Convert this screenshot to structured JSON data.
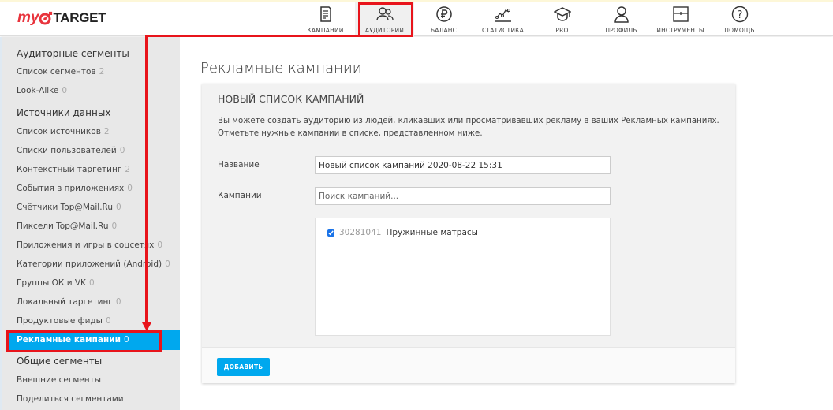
{
  "logo": {
    "my": "my",
    "target": "TARGET"
  },
  "nav": [
    {
      "label": "КАМПАНИИ",
      "icon": "document-icon"
    },
    {
      "label": "АУДИТОРИИ",
      "icon": "users-icon"
    },
    {
      "label": "БАЛАНС",
      "icon": "ruble-icon"
    },
    {
      "label": "СТАТИСТИКА",
      "icon": "chart-line-icon"
    },
    {
      "label": "PRO",
      "icon": "graduation-cap-icon"
    },
    {
      "label": "ПРОФИЛЬ",
      "icon": "user-icon"
    },
    {
      "label": "ИНСТРУМЕНТЫ",
      "icon": "tools-icon"
    },
    {
      "label": "ПОМОЩЬ",
      "icon": "help-icon"
    }
  ],
  "sidebar": {
    "h1": "Аудиторные сегменты",
    "h2": "Источники данных",
    "h3": "Общие сегменты",
    "items": [
      {
        "label": "Список сегментов",
        "count": "2"
      },
      {
        "label": "Look-Alike",
        "count": "0"
      },
      {
        "label": "Список источников",
        "count": "2"
      },
      {
        "label": "Списки пользователей",
        "count": "0"
      },
      {
        "label": "Контекстный таргетинг",
        "count": "2"
      },
      {
        "label": "События в приложениях",
        "count": "0"
      },
      {
        "label": "Счётчики Top@Mail.Ru",
        "count": "0"
      },
      {
        "label": "Пиксели Top@Mail.Ru",
        "count": "0"
      },
      {
        "label": "Приложения и игры в соцсетях",
        "count": "0"
      },
      {
        "label": "Категории приложений (Android)",
        "count": "0"
      },
      {
        "label": "Группы ОК и VK",
        "count": "0"
      },
      {
        "label": "Локальный таргетинг",
        "count": "0"
      },
      {
        "label": "Продуктовые фиды",
        "count": "0"
      },
      {
        "label": "Рекламные кампании",
        "count": "0"
      },
      {
        "label": "Внешние сегменты"
      },
      {
        "label": "Поделиться сегментами"
      }
    ]
  },
  "page": {
    "title": "Рекламные кампании",
    "card_title": "НОВЫЙ СПИСОК КАМПАНИЙ",
    "desc1": "Вы можете создать аудиторию из людей, кликавших или просматривавших рекламу в ваших Рекламных кампаниях.",
    "desc2": "Отметьте нужные кампании в списке, представленном ниже.",
    "name_label": "Название",
    "name_value": "Новый список кампаний 2020-08-22 15:31",
    "campaigns_label": "Кампании",
    "search_placeholder": "Поиск кампаний...",
    "campaigns": [
      {
        "id": "30281041",
        "name": "Пружинные матрасы",
        "checked": true
      }
    ],
    "add_button": "ДОБАВИТЬ"
  },
  "colors": {
    "accent": "#00a8ee",
    "annotation": "#e8141b",
    "brand": "#e8333c"
  }
}
